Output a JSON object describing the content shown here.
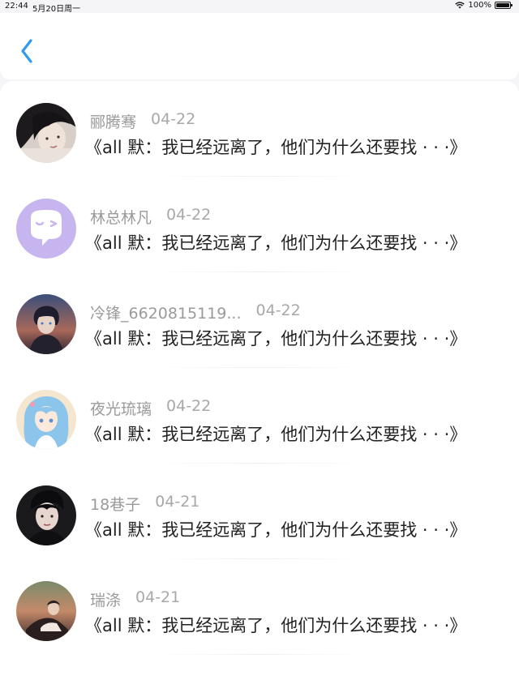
{
  "status_bar": {
    "time": "22:44",
    "date": "5月20日周一",
    "battery": "100%"
  },
  "nav": {
    "back_icon": "chevron-left-icon",
    "accent_color": "#2f9bf0"
  },
  "items": [
    {
      "name": "郦腾骞",
      "date": "04-22",
      "text": "《all 默：我已经远离了，他们为什么还要找 · · ·》",
      "avatar": "dark-hair-portrait"
    },
    {
      "name": "林总林凡",
      "date": "04-22",
      "text": "《all 默：我已经远离了，他们为什么还要找 · · ·》",
      "avatar": "purple-chat-bubble"
    },
    {
      "name": "冷锋_6620815119...",
      "date": "04-22",
      "text": "《all 默：我已经远离了，他们为什么还要找 · · ·》",
      "avatar": "anime-boy-night"
    },
    {
      "name": "夜光琉璃",
      "date": "04-22",
      "text": "《all 默：我已经远离了，他们为什么还要找 · · ·》",
      "avatar": "anime-girl-blue-hair"
    },
    {
      "name": "18巷子",
      "date": "04-21",
      "text": "《all 默：我已经远离了，他们为什么还要找 · · ·》",
      "avatar": "young-man-portrait"
    },
    {
      "name": "瑞涤",
      "date": "04-21",
      "text": "《all 默：我已经远离了，他们为什么还要找 · · ·》",
      "avatar": "dusk-figure"
    }
  ]
}
